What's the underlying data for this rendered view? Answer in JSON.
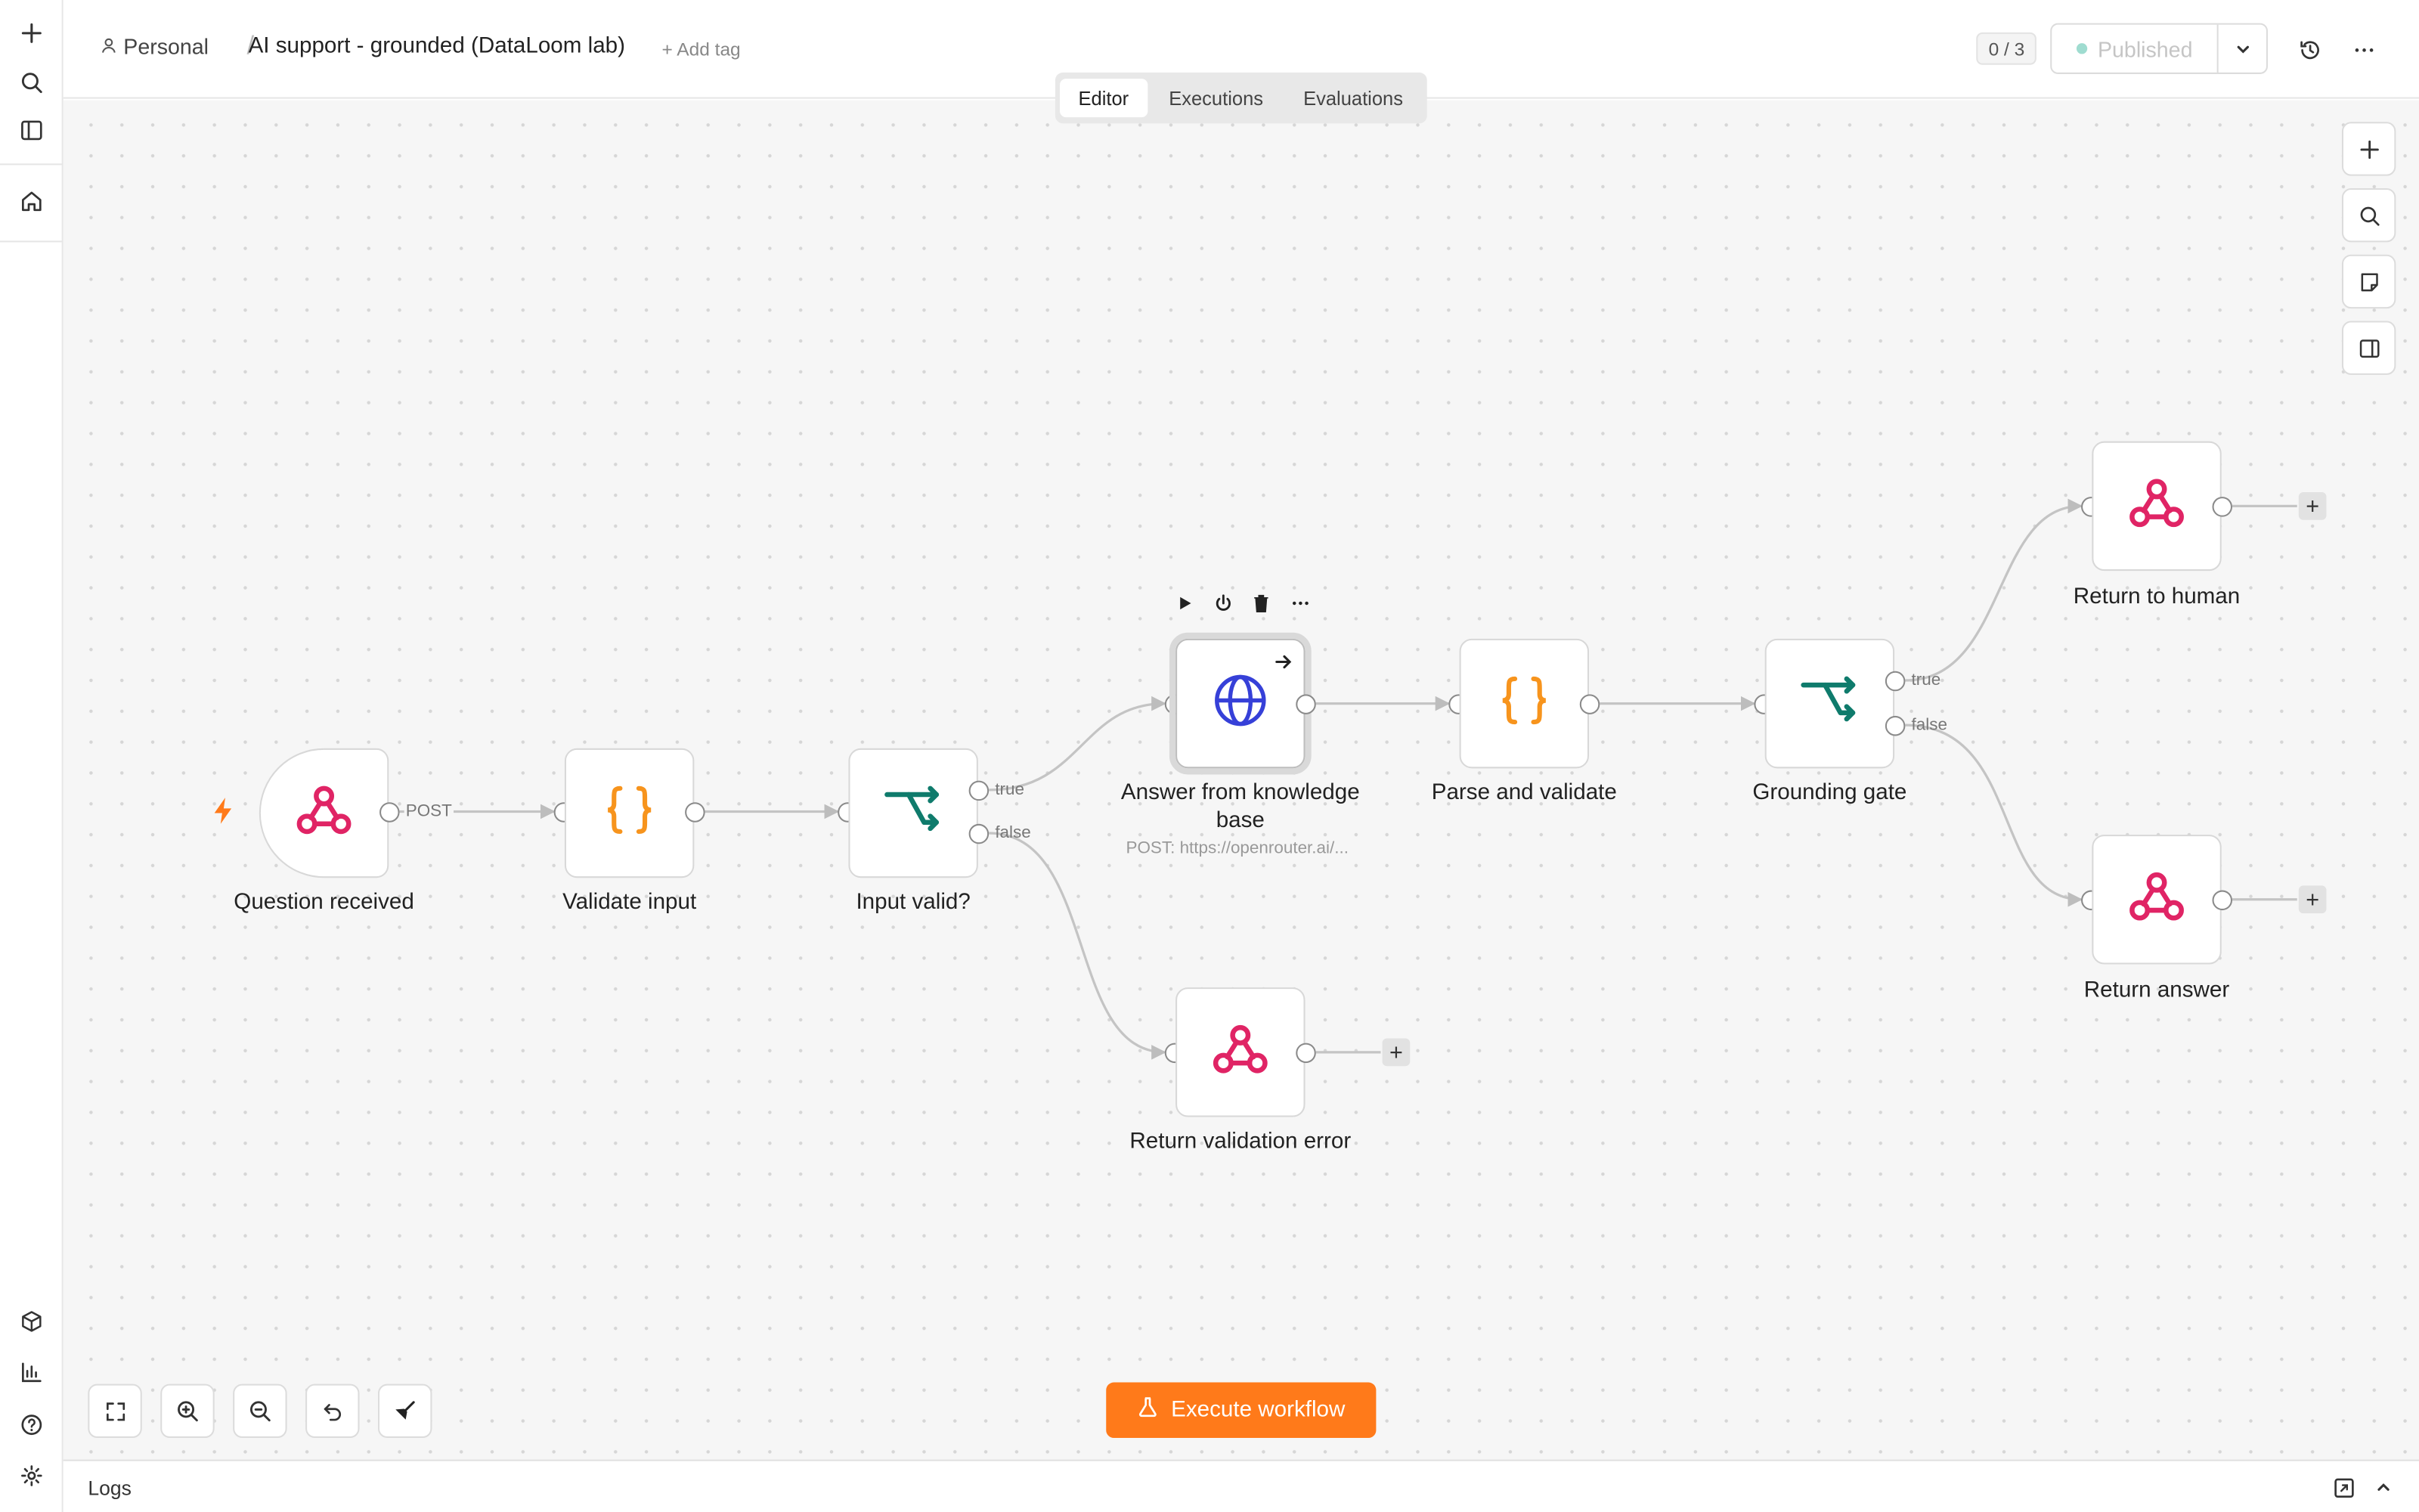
{
  "header": {
    "owner": "Personal",
    "separator": "/",
    "workflow_name": "AI support - grounded (DataLoom lab)",
    "add_tag": "+ Add tag",
    "counter": "0 / 3",
    "publish_label": "Published"
  },
  "tabs": [
    {
      "label": "Editor",
      "active": true
    },
    {
      "label": "Executions",
      "active": false
    },
    {
      "label": "Evaluations",
      "active": false
    }
  ],
  "nodes": {
    "question_received": {
      "label": "Question received",
      "output": "POST",
      "icon": "webhook-icon"
    },
    "validate_input": {
      "label": "Validate input",
      "icon": "code-braces-icon"
    },
    "input_valid": {
      "label": "Input valid?",
      "out_true": "true",
      "out_false": "false",
      "icon": "branch-icon"
    },
    "answer_kb": {
      "label": "Answer from knowledge base",
      "subtitle": "POST: https://openrouter.ai/...",
      "icon": "globe-icon"
    },
    "parse_validate": {
      "label": "Parse and validate",
      "icon": "code-braces-icon"
    },
    "grounding_gate": {
      "label": "Grounding gate",
      "out_true": "true",
      "out_false": "false",
      "icon": "branch-icon"
    },
    "return_human": {
      "label": "Return to human",
      "icon": "webhook-icon"
    },
    "return_answer": {
      "label": "Return answer",
      "icon": "webhook-icon"
    },
    "return_error": {
      "label": "Return validation error",
      "icon": "webhook-icon"
    }
  },
  "actions": {
    "execute_label": "Execute workflow"
  },
  "logs": {
    "label": "Logs"
  },
  "colors": {
    "accent": "#ff7a1a",
    "webhook": "#e02465",
    "code": "#f7941d",
    "branch": "#0f7b6c",
    "http": "#3640d8"
  }
}
